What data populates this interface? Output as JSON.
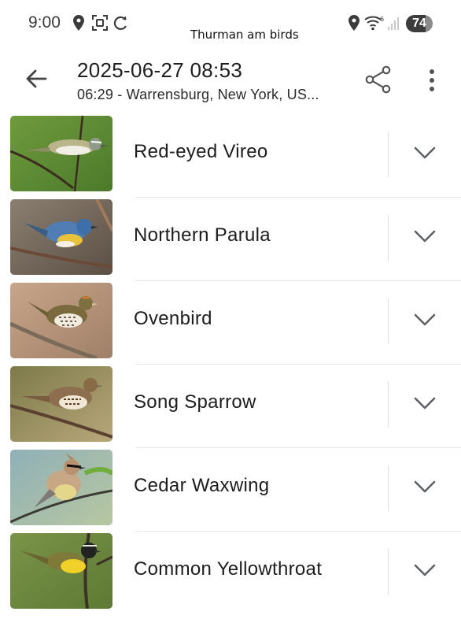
{
  "status_bar": {
    "time": "9:00",
    "caption": "Thurman am birds",
    "battery": 74,
    "battery_label": "74",
    "left_icons": [
      "location-icon",
      "screenshot-icon",
      "sync-icon"
    ],
    "right_icons": [
      "location-icon",
      "wifi-6-icon",
      "signal-icon"
    ]
  },
  "app_bar": {
    "title": "2025-06-27 08:53",
    "subtitle": "06:29 - Warrensburg, New York, US..."
  },
  "birds": [
    {
      "name": "Red-eyed Vireo",
      "photo": "red-eyed-vireo-photo"
    },
    {
      "name": "Northern Parula",
      "photo": "northern-parula-photo"
    },
    {
      "name": "Ovenbird",
      "photo": "ovenbird-photo"
    },
    {
      "name": "Song Sparrow",
      "photo": "song-sparrow-photo"
    },
    {
      "name": "Cedar Waxwing",
      "photo": "cedar-waxwing-photo"
    },
    {
      "name": "Common Yellowthroat",
      "photo": "common-yellowthroat-photo"
    }
  ],
  "colors": {
    "text": "#1d1d1d",
    "divider": "#e6e6e6",
    "icon": "#5f6368"
  }
}
